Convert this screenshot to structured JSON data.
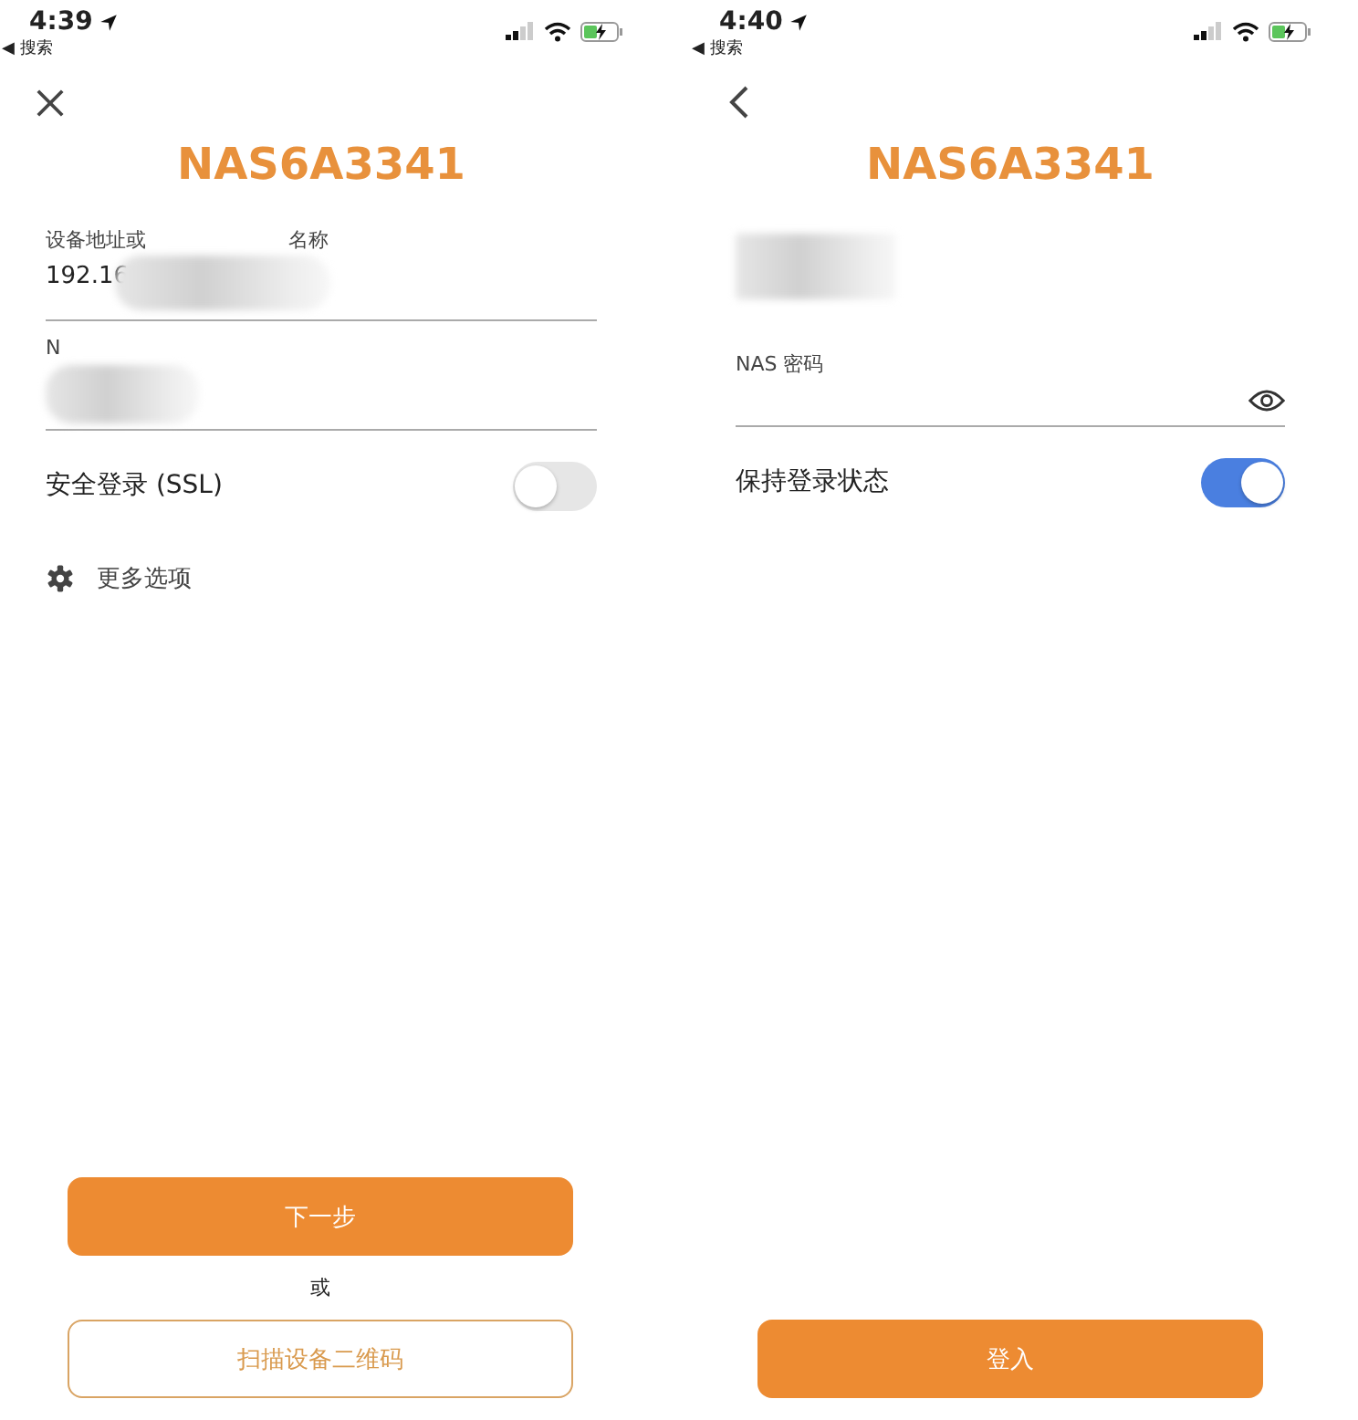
{
  "screens": [
    {
      "status": {
        "time": "4:39",
        "back_app": "◀ 搜索"
      },
      "nav": {
        "kind": "close"
      },
      "title": "NAS6A3341",
      "fields": [
        {
          "kind": "text",
          "label": [
            "设备地址或",
            "名称"
          ],
          "value": "192.16",
          "redacted": true
        },
        {
          "kind": "text",
          "label": [
            "N"
          ],
          "redacted": true
        }
      ],
      "toggles": [
        {
          "label": "安全登录 (SSL)",
          "on": false
        }
      ],
      "more_options": "更多选项",
      "bottom": [
        {
          "kind": "primary",
          "label": "下一步"
        },
        {
          "kind": "text",
          "label": "或"
        },
        {
          "kind": "outline",
          "label": "扫描设备二维码"
        }
      ]
    },
    {
      "status": {
        "time": "4:40",
        "back_app": "◀ 搜索"
      },
      "nav": {
        "kind": "back"
      },
      "title": "NAS6A3341",
      "fields": [
        {
          "kind": "hidden",
          "redacted": true
        },
        {
          "kind": "password",
          "label": [
            "NAS 密码"
          ]
        }
      ],
      "toggles": [
        {
          "label": "保持登录状态",
          "on": true
        }
      ],
      "bottom": [
        {
          "kind": "primary",
          "label": "登入"
        }
      ]
    }
  ]
}
